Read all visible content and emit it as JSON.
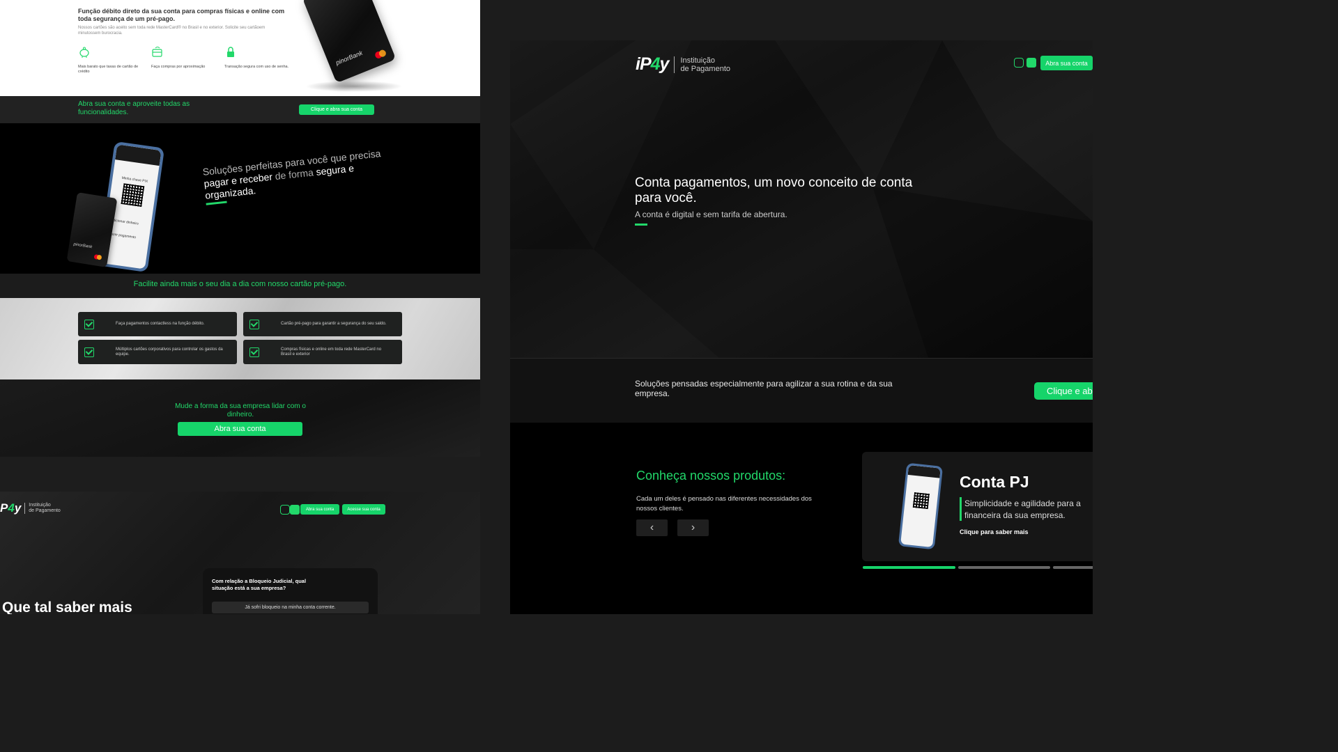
{
  "left": {
    "card_section": {
      "heading": "Função débito direto da sua conta para compras físicas e online com toda segurança de um pré-pago.",
      "subtext": "Nossos cartões são aceito sem toda rede MasterCard® no Brasil e no exterior. Solicite seu cartãoem minutossem burocracia.",
      "features": [
        {
          "icon": "piggy-bank-icon",
          "label": "Mais barato que taxas de cartão de crédito"
        },
        {
          "icon": "card-contactless-icon",
          "label": "Faça compras por aproximação"
        },
        {
          "icon": "lock-icon",
          "label": "Transação segura com uso de senha."
        }
      ],
      "card_brand": "pinorBank"
    },
    "cta_bar": {
      "text": "Abra sua conta e aproveite todas as funcionalidades.",
      "button": "Clique e abra sua conta"
    },
    "hero": {
      "line1": "Soluções perfeitas para você que precisa",
      "line2a": "pagar e receber",
      "line2b": " de forma ",
      "line2c": "segura e",
      "line3": "organizada."
    },
    "phone": {
      "pix_label": "Minha chave PIX",
      "add_money": "Adicionar dinheiro",
      "pay": "Fazer pagamento"
    },
    "facilite": "Facilite ainda mais o seu dia a dia com nosso cartão pré-pago.",
    "feature_boxes": [
      "Faça pagamentos contactless na função débito.",
      "Cartão pré-pago para garantir a segurança do seu saldo.",
      "Múltiplos cartões corporativos para controlar os gastos da equipe.",
      "Compras físicas e online em toda rede MasterCard no Brasil e exterior"
    ],
    "mude": {
      "text": "Mude a forma da sua empresa lidar com o dinheiro.",
      "button": "Abra sua conta"
    },
    "bottom_nav": {
      "logo_text1": "Instituição",
      "logo_text2": "de Pagamento",
      "btn_open": "Abra sua conta",
      "btn_access": "Acesse sua conta"
    },
    "quiz": {
      "question": "Com relação a Bloqueio Judicial, qual situação está a sua empresa?",
      "option1": "Já sofri bloqueio na minha conta corrente."
    },
    "bottom_heading": "Que tal saber mais"
  },
  "right": {
    "nav": {
      "logo_text1": "Instituição",
      "logo_text2": "de Pagamento",
      "btn_open": "Abra sua conta"
    },
    "hero": {
      "title": "Conta pagamentos, um novo conceito de conta para você.",
      "subtitle": "A conta é digital e sem tarifa de abertura."
    },
    "solutions": {
      "text": "Soluções pensadas especialmente para agilizar a sua rotina e da sua empresa.",
      "button": "Clique e ab"
    },
    "products": {
      "title": "Conheça nossos produtos:",
      "desc": "Cada um deles é pensado nas diferentes necessidades dos nossos clientes.",
      "card_title": "Conta PJ",
      "card_desc": "Simplicidade e agilidade para a financeira da sua empresa.",
      "card_link": "Clique para saber mais"
    }
  },
  "colors": {
    "accent": "#16d46a",
    "dark": "#0b0b0b"
  }
}
